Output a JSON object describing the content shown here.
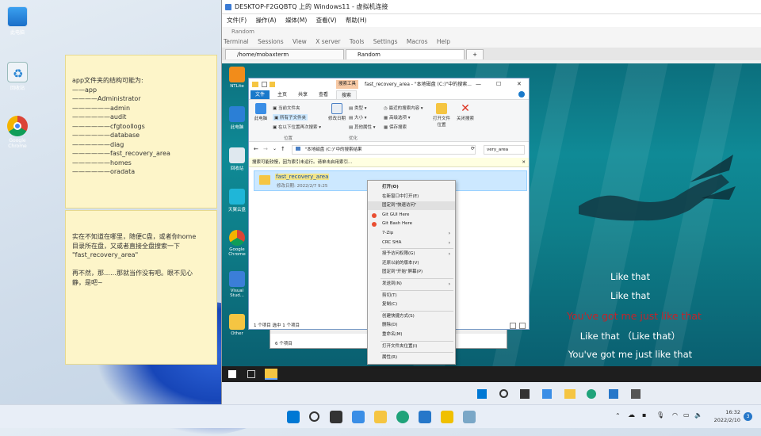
{
  "host_desktop": {
    "icons": [
      {
        "label": "此电脑",
        "icon": "monitor-icon"
      },
      {
        "label": "回收站",
        "icon": "recycle-bin-icon"
      },
      {
        "label": "Google Chrome",
        "icon": "chrome-icon"
      }
    ]
  },
  "note1": {
    "lines": [
      "app文件夹的结构可能为:",
      "——app",
      "————Administrator",
      "——————admin",
      "——————audit",
      "——————cfgtoollogs",
      "——————database",
      "——————diag",
      "——————fast_recovery_area",
      "——————homes",
      "——————oradata"
    ]
  },
  "note2": {
    "lines": [
      "实在不知道在哪里，随便C盘，或者你home",
      "目录所在盘，又或者直接全盘搜索一下",
      "\"fast_recovery_area\"",
      "",
      "再不然，那……那就当作没有吧。眼不见心",
      "静，是吧~"
    ]
  },
  "vm_window": {
    "title": "DESKTOP-F2GQBTQ 上的 Windows11 - 虚拟机连接",
    "menu": [
      "文件(F)",
      "操作(A)",
      "媒体(M)",
      "查看(V)",
      "帮助(H)"
    ]
  },
  "mobaxterm": {
    "title": "Random",
    "menu": [
      "Terminal",
      "Sessions",
      "View",
      "X server",
      "Tools",
      "Settings",
      "Macros",
      "Help"
    ],
    "tabs": [
      "/home/mobaxterm",
      "Random"
    ]
  },
  "remote_desktop": {
    "icons": [
      "NTLite",
      "此电脑",
      "回收站",
      "天翼云盘",
      "Google Chrome",
      "Visual Stud...",
      "Other"
    ]
  },
  "lyrics": [
    "Like that",
    "Like that",
    "You've got me just like that",
    "Like that （Like that）",
    "You've got me just like that"
  ],
  "explorer": {
    "title": "fast_recovery_area - \"本地磁盘 (C:)\"中的搜索...",
    "tool_label": "搜索工具",
    "ribbon_tabs": [
      "文件",
      "主页",
      "共享",
      "查看",
      "搜索"
    ],
    "ribbon": {
      "computer": "此电脑",
      "current_folder": "当前文件夹",
      "all_subfolders": "所有子文件夹",
      "search_again": "在以下位置再次搜索 ▾",
      "location_group": "位置",
      "modified": "修改日期",
      "kind": "类型 ▾",
      "size": "大小 ▾",
      "other_props": "其他属性 ▾",
      "optimize_group": "优化",
      "recent": "最近的搜索内容 ▾",
      "advanced": "高级选项 ▾",
      "save_search": "保存搜索",
      "open_location": "打开文件位置",
      "close_search": "关闭搜索"
    },
    "address": "\"本地磁盘 (C:)\"中的搜索结果",
    "search_box": "very_area",
    "info_bar": "搜索可能较慢，因为索引未运行。请单击启用索引...",
    "result_name": "fast_recovery_area",
    "result_meta": "修改日期: 2022/2/7 9:25",
    "status": "1 个项目    选中 1 个项目"
  },
  "context_menu": {
    "items": [
      {
        "label": "打开(O)",
        "bold": true
      },
      {
        "label": "在新窗口中打开(E)"
      },
      {
        "label": "固定到\"快速访问\"",
        "highlight": true
      },
      {
        "label": "Git GUI Here",
        "icon": true
      },
      {
        "label": "Git Bash Here",
        "icon": true
      },
      {
        "label": "7-Zip",
        "submenu": true
      },
      {
        "label": "CRC SHA",
        "submenu": true
      },
      {
        "sep": true
      },
      {
        "label": "授予访问权限(G)",
        "submenu": true
      },
      {
        "label": "还原以前的版本(V)"
      },
      {
        "label": "固定到\"开始\"屏幕(P)"
      },
      {
        "sep": true
      },
      {
        "label": "发送到(N)",
        "submenu": true
      },
      {
        "sep": true
      },
      {
        "label": "剪切(T)"
      },
      {
        "label": "复制(C)"
      },
      {
        "sep": true
      },
      {
        "label": "创建快捷方式(S)"
      },
      {
        "label": "删除(D)"
      },
      {
        "label": "重命名(M)"
      },
      {
        "sep": true
      },
      {
        "label": "打开文件夹位置(I)"
      },
      {
        "sep": true
      },
      {
        "label": "属性(R)"
      }
    ]
  },
  "background_window": {
    "status": "6 个项目"
  },
  "host_taskbar": {
    "time": "16:32",
    "date": "2022/2/10",
    "notifications": "3"
  },
  "colors": {
    "accent": "#0078d4",
    "lyric_highlight": "#c4232a",
    "note_bg": "#fdf5c9"
  }
}
